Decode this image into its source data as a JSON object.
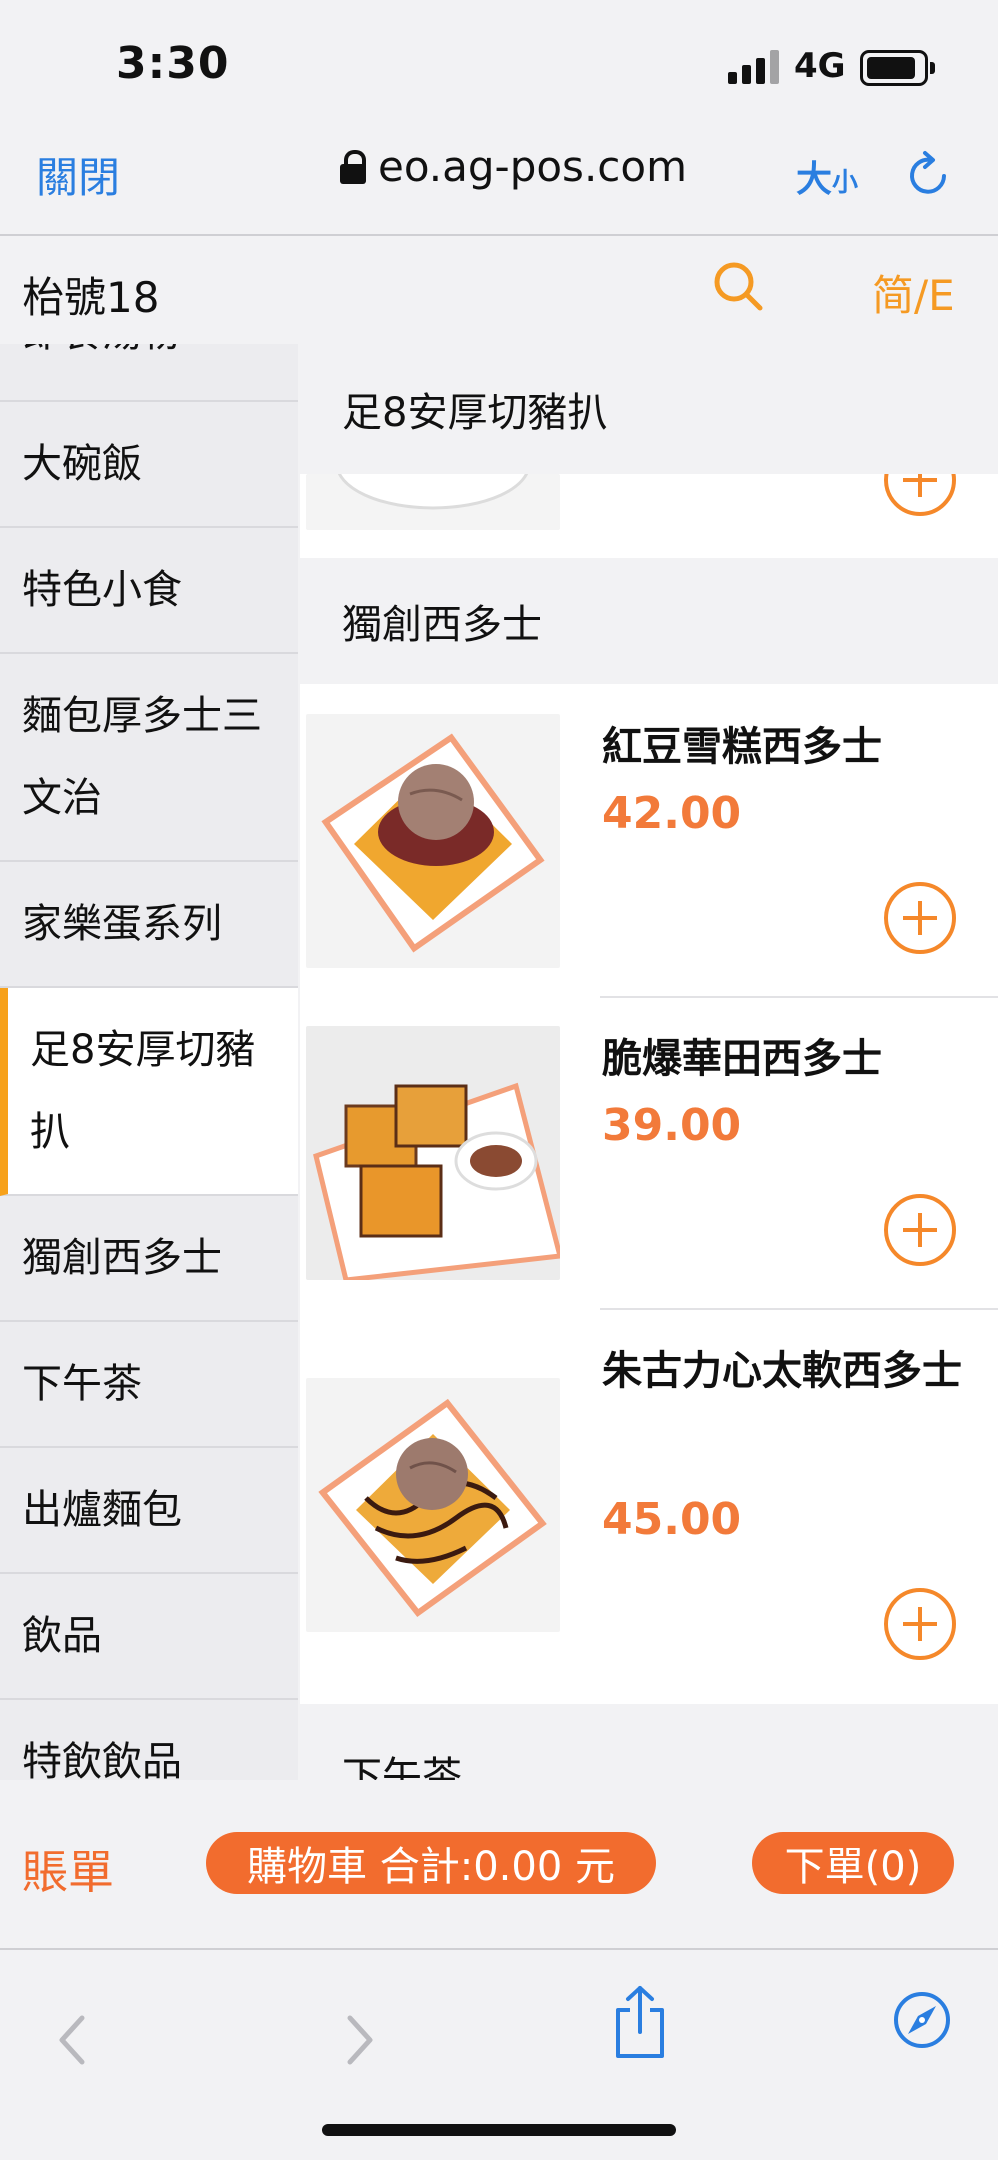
{
  "status_bar": {
    "time": "3:30",
    "network": "4G"
  },
  "browser": {
    "close_label": "關閉",
    "url": "eo.ag-pos.com",
    "text_size_big": "大",
    "text_size_small": "小"
  },
  "header": {
    "store_name": "枱號18",
    "lang_label": "简/E"
  },
  "sidebar": {
    "partial_item": "即食湯粉",
    "items": [
      {
        "label": "大碗飯"
      },
      {
        "label": "特色小食"
      },
      {
        "label": "麵包厚多士三文治"
      },
      {
        "label": "家樂蛋系列"
      },
      {
        "label": "足8安厚切豬扒",
        "active": true
      },
      {
        "label": "獨創西多士"
      },
      {
        "label": "下午茶"
      },
      {
        "label": "出爐麵包"
      },
      {
        "label": "飲品"
      },
      {
        "label": "特飲飲品"
      }
    ]
  },
  "main": {
    "sticky_section": "足8安厚切豬扒",
    "section_title": "獨創西多士",
    "products": [
      {
        "name": "紅豆雪糕西多士",
        "price": "42.00"
      },
      {
        "name": "脆爆華田西多士",
        "price": "39.00"
      },
      {
        "name": "朱古力心太軟西多士",
        "price": "45.00"
      }
    ],
    "next_section": "下午茶"
  },
  "bottom_bar": {
    "bill_label": "賬單",
    "cart_label": "購物車 合計:0.00 元",
    "order_label": "下單(0)"
  },
  "colors": {
    "accent_orange": "#f26c2e",
    "ios_blue": "#2a7ee0",
    "active_marker": "#f7a11a"
  }
}
